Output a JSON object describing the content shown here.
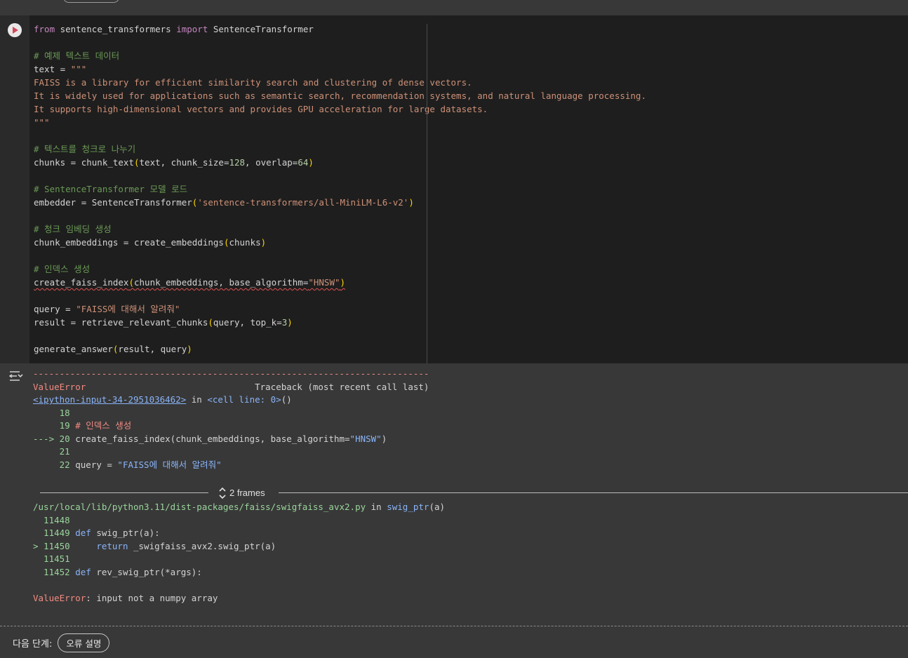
{
  "cell": {
    "lines": [
      [
        {
          "c": "kw",
          "t": "from"
        },
        {
          "c": "id",
          "t": " sentence_transformers "
        },
        {
          "c": "kw",
          "t": "import"
        },
        {
          "c": "id",
          "t": " SentenceTransformer"
        }
      ],
      [],
      [
        {
          "c": "cm",
          "t": "# 예제 텍스트 데이터"
        }
      ],
      [
        {
          "c": "id",
          "t": "text = "
        },
        {
          "c": "st",
          "t": "\"\"\""
        }
      ],
      [
        {
          "c": "st",
          "t": "FAISS is a library for efficient similarity search and clustering of dense vectors."
        }
      ],
      [
        {
          "c": "st",
          "t": "It is widely used for applications such as semantic search, recommendation systems, and natural language processing."
        }
      ],
      [
        {
          "c": "st",
          "t": "It supports high-dimensional vectors and provides GPU acceleration for large datasets."
        }
      ],
      [
        {
          "c": "st",
          "t": "\"\"\""
        }
      ],
      [],
      [
        {
          "c": "cm",
          "t": "# 텍스트를 청크로 나누기"
        }
      ],
      [
        {
          "c": "id",
          "t": "chunks = chunk_text"
        },
        {
          "c": "pn",
          "t": "("
        },
        {
          "c": "id",
          "t": "text, chunk_size="
        },
        {
          "c": "nm",
          "t": "128"
        },
        {
          "c": "id",
          "t": ", overlap="
        },
        {
          "c": "nm",
          "t": "64"
        },
        {
          "c": "pn",
          "t": ")"
        }
      ],
      [],
      [
        {
          "c": "cm",
          "t": "# SentenceTransformer 모델 로드"
        }
      ],
      [
        {
          "c": "id",
          "t": "embedder = SentenceTransformer"
        },
        {
          "c": "pn",
          "t": "("
        },
        {
          "c": "st",
          "t": "'sentence-transformers/all-MiniLM-L6-v2'"
        },
        {
          "c": "pn",
          "t": ")"
        }
      ],
      [],
      [
        {
          "c": "cm",
          "t": "# 청크 임베딩 생성"
        }
      ],
      [
        {
          "c": "id",
          "t": "chunk_embeddings = create_embeddings"
        },
        {
          "c": "pn",
          "t": "("
        },
        {
          "c": "id",
          "t": "chunks"
        },
        {
          "c": "pn",
          "t": ")"
        }
      ],
      [],
      [
        {
          "c": "cm",
          "t": "# 인덱스 생성"
        }
      ],
      [
        {
          "c": "id squig",
          "t": "create_faiss_index"
        },
        {
          "c": "pn squig",
          "t": "("
        },
        {
          "c": "id squig",
          "t": "chunk_embeddings, base_algorithm="
        },
        {
          "c": "st squig",
          "t": "\"HNSW\""
        },
        {
          "c": "pn squig",
          "t": ")"
        }
      ],
      [],
      [
        {
          "c": "id",
          "t": "query = "
        },
        {
          "c": "st",
          "t": "\"FAISS에 대해서 알려줘\""
        }
      ],
      [
        {
          "c": "id",
          "t": "result = retrieve_relevant_chunks"
        },
        {
          "c": "pn",
          "t": "("
        },
        {
          "c": "id",
          "t": "query, top_k="
        },
        {
          "c": "nm",
          "t": "3"
        },
        {
          "c": "pn",
          "t": ")"
        }
      ],
      [],
      [
        {
          "c": "id",
          "t": "generate_answer"
        },
        {
          "c": "pn",
          "t": "("
        },
        {
          "c": "id",
          "t": "result, query"
        },
        {
          "c": "pn",
          "t": ")"
        }
      ]
    ]
  },
  "traceback": {
    "lines": [
      [
        {
          "c": "red",
          "t": "---------------------------------------------------------------------------"
        }
      ],
      [
        {
          "c": "red",
          "t": "ValueError"
        },
        {
          "c": "id",
          "t": "                                Traceback (most recent call last)"
        }
      ],
      [
        {
          "c": "lnk",
          "t": "<ipython-input-34-2951036462>"
        },
        {
          "c": "id",
          "t": " in "
        },
        {
          "c": "blu",
          "t": "<cell line: 0>"
        },
        {
          "c": "id",
          "t": "()"
        }
      ],
      [
        {
          "c": "grn",
          "t": "     18"
        }
      ],
      [
        {
          "c": "grn",
          "t": "     19"
        },
        {
          "c": "red",
          "t": " # 인덱스 생성"
        }
      ],
      [
        {
          "c": "grn",
          "t": "---> 20"
        },
        {
          "c": "id",
          "t": " create_faiss_index(chunk_embeddings, base_algorithm="
        },
        {
          "c": "blu",
          "t": "\"HNSW\""
        },
        {
          "c": "id",
          "t": ")"
        }
      ],
      [
        {
          "c": "grn",
          "t": "     21"
        }
      ],
      [
        {
          "c": "grn",
          "t": "     22"
        },
        {
          "c": "id",
          "t": " query = "
        },
        {
          "c": "blu",
          "t": "\"FAISS에 대해서 알려줘\""
        }
      ]
    ],
    "frames_label": "2 frames",
    "lines2": [
      [
        {
          "c": "grn",
          "t": "/usr/local/lib/python3.11/dist-packages/faiss/swigfaiss_avx2.py"
        },
        {
          "c": "id",
          "t": " in "
        },
        {
          "c": "blu",
          "t": "swig_ptr"
        },
        {
          "c": "id",
          "t": "(a)"
        }
      ],
      [
        {
          "c": "grn",
          "t": "  11448"
        }
      ],
      [
        {
          "c": "grn",
          "t": "  11449"
        },
        {
          "c": "blu",
          "t": " def"
        },
        {
          "c": "id",
          "t": " swig_ptr(a):"
        }
      ],
      [
        {
          "c": "grn",
          "t": "> 11450"
        },
        {
          "c": "blu",
          "t": "     return"
        },
        {
          "c": "id",
          "t": " _swigfaiss_avx2.swig_ptr(a)"
        }
      ],
      [
        {
          "c": "grn",
          "t": "  11451"
        }
      ],
      [
        {
          "c": "grn",
          "t": "  11452"
        },
        {
          "c": "blu",
          "t": " def"
        },
        {
          "c": "id",
          "t": " rev_swig_ptr(*args):"
        }
      ],
      [],
      [
        {
          "c": "red",
          "t": "ValueError"
        },
        {
          "c": "id",
          "t": ": input not a numpy array"
        }
      ]
    ]
  },
  "next_steps": {
    "label": "다음 단계:",
    "button": "오류 설명"
  },
  "icons": {
    "run": "play-circle-icon",
    "output": "output-toggle-icon",
    "frames": "expand-vertical-icon"
  }
}
